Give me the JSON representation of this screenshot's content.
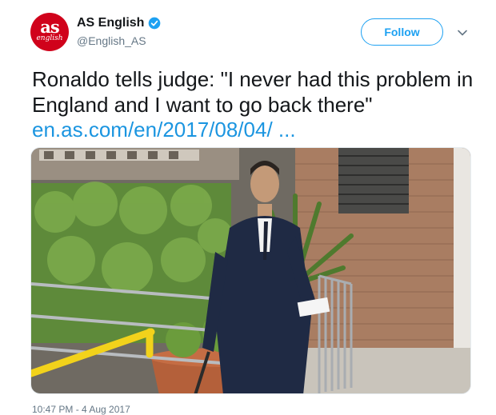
{
  "account": {
    "avatar_big": "as",
    "avatar_small": "english",
    "display_name": "AS English",
    "handle": "@English_AS",
    "verified": true,
    "avatar_color": "#d0021b"
  },
  "actions": {
    "follow_label": "Follow",
    "menu_icon": "chevron-down-icon"
  },
  "tweet": {
    "text": "Ronaldo tells judge: \"I never had this problem in England and I want to go back there\"",
    "link_text": "en.as.com/en/2017/08/04/ ...",
    "link_color": "#1b95e0",
    "timestamp": "10:47 PM - 4 Aug 2017"
  },
  "colors": {
    "accent": "#1da1f2",
    "text": "#14171a",
    "muted": "#657786"
  }
}
